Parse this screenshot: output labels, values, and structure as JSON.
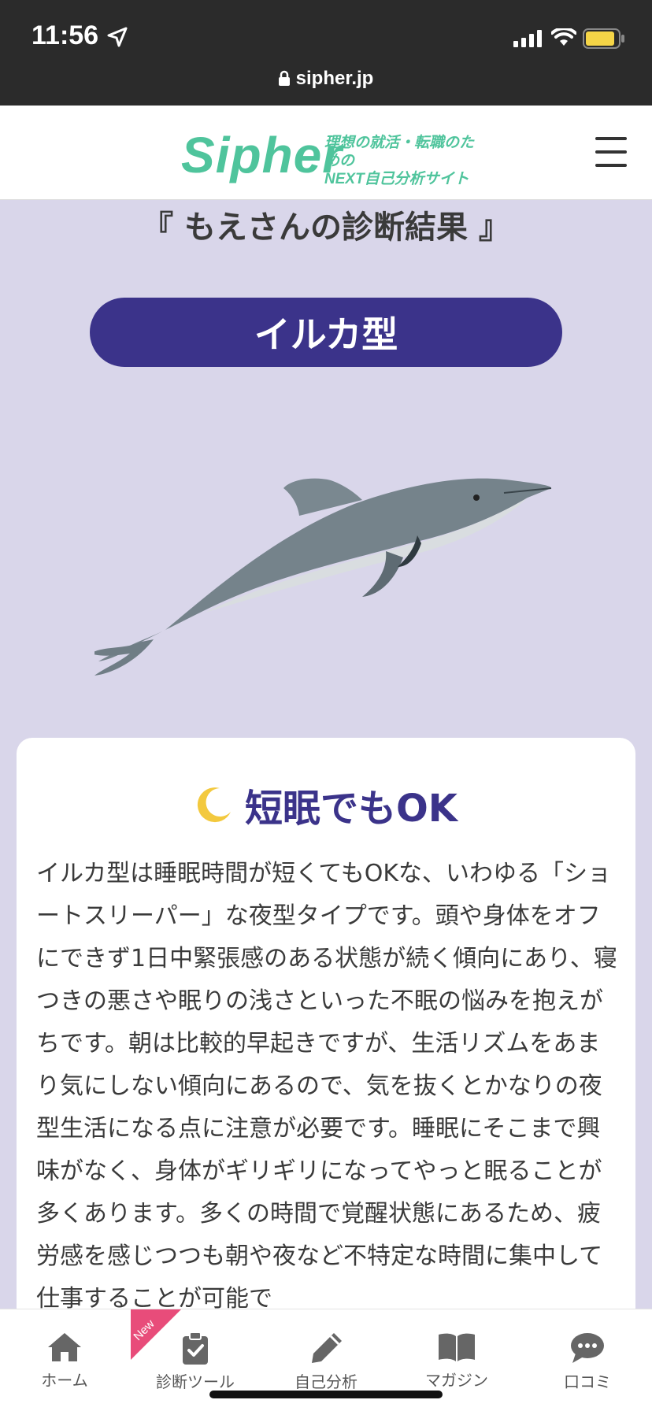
{
  "status_bar": {
    "time": "11:56",
    "url": "sipher.jp"
  },
  "header": {
    "logo": "Sipher",
    "tagline_line1": "理想の就活・転職のための",
    "tagline_line2": "NEXT自己分析サイト"
  },
  "result": {
    "title": "『 もえさんの診断結果 』",
    "type_label": "イルカ型"
  },
  "card": {
    "heading": "短眠でもOK",
    "body": "イルカ型は睡眠時間が短くてもOKな、いわゆる「ショートスリーパー」な夜型タイプです。頭や身体をオフにできず1日中緊張感のある状態が続く傾向にあり、寝つきの悪さや眠りの浅さといった不眠の悩みを抱えがちです。朝は比較的早起きですが、生活リズムをあまり気にしない傾向にあるので、気を抜くとかなりの夜型生活になる点に注意が必要です。睡眠にそこまで興味がなく、身体がギリギリになってやっと眠ることが多くあります。多くの時間で覚醒状態にあるため、疲労感を感じつつも朝や夜など不特定な時間に集中して仕事することが可能で"
  },
  "tabbar": {
    "new_badge": "New",
    "items": [
      {
        "label": "ホーム",
        "icon": "home-icon"
      },
      {
        "label": "診断ツール",
        "icon": "clipboard-check-icon"
      },
      {
        "label": "自己分析",
        "icon": "pencil-icon"
      },
      {
        "label": "マガジン",
        "icon": "book-icon"
      },
      {
        "label": "口コミ",
        "icon": "chat-icon"
      }
    ]
  },
  "colors": {
    "accent": "#3b338a",
    "brand": "#4fc49c",
    "background": "#d9d6ea",
    "new_badge": "#e84c7a"
  }
}
